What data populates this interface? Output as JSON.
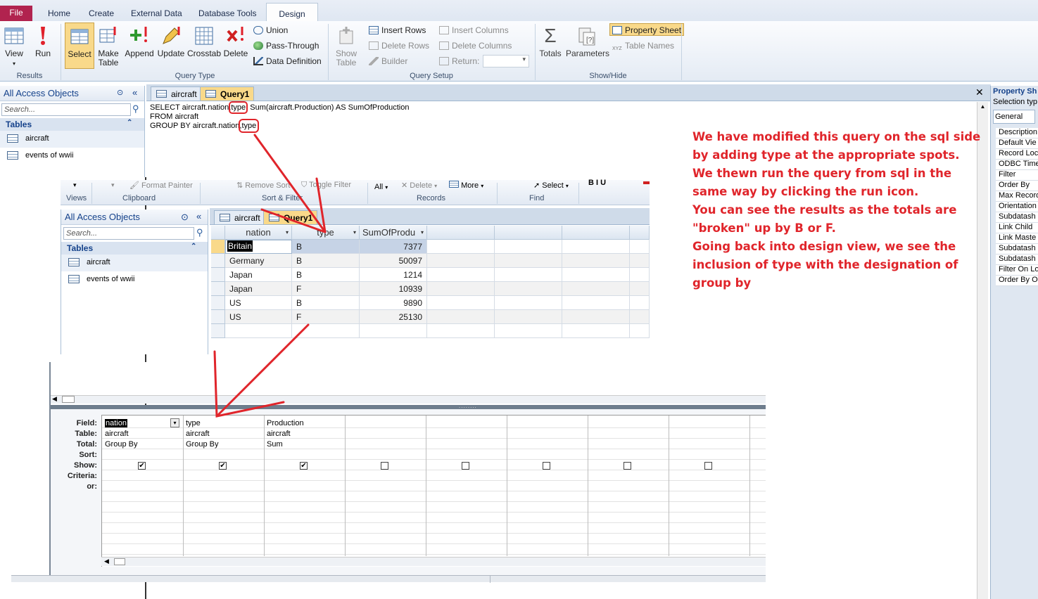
{
  "ribbon": {
    "tabs": [
      "File",
      "Home",
      "Create",
      "External Data",
      "Database Tools",
      "Design"
    ],
    "results": {
      "view": "View",
      "run": "Run",
      "label": "Results"
    },
    "query_type": {
      "select": "Select",
      "make_table_1": "Make",
      "make_table_2": "Table",
      "append": "Append",
      "update": "Update",
      "crosstab": "Crosstab",
      "delete": "Delete",
      "union": "Union",
      "pass_through": "Pass-Through",
      "data_definition": "Data Definition",
      "label": "Query Type"
    },
    "query_setup": {
      "show_table_1": "Show",
      "show_table_2": "Table",
      "insert_rows": "Insert Rows",
      "delete_rows": "Delete Rows",
      "builder": "Builder",
      "insert_columns": "Insert Columns",
      "delete_columns": "Delete Columns",
      "return": "Return:",
      "label": "Query Setup"
    },
    "show_hide": {
      "totals": "Totals",
      "parameters": "Parameters",
      "property_sheet": "Property Sheet",
      "table_names": "Table Names",
      "label": "Show/Hide"
    }
  },
  "nav": {
    "title": "All Access Objects",
    "search_placeholder": "Search...",
    "group": "Tables",
    "items": [
      "aircraft",
      "events of wwii"
    ]
  },
  "doc_tabs": [
    "aircraft",
    "Query1"
  ],
  "sql": {
    "line1a": "SELECT aircraft.nation,",
    "line1b": "type",
    "line1c": ", Sum(aircraft.Production) AS SumOfProduction",
    "line2": "FROM aircraft",
    "line3a": "GROUP BY aircraft.nation,",
    "line3b": "type"
  },
  "home_ribbon": {
    "format_painter": "Format Painter",
    "remove_sort": "Remove Sort",
    "toggle_filter": "Toggle Filter",
    "all": "All",
    "delete": "Delete",
    "more": "More",
    "select": "Select",
    "views": "Views",
    "clipboard": "Clipboard",
    "sort_filter": "Sort & Filter",
    "records": "Records",
    "find": "Find"
  },
  "datasheet": {
    "headers": [
      "nation",
      "type",
      "SumOfProdu"
    ],
    "rows": [
      [
        "Britain",
        "B",
        "7377"
      ],
      [
        "Germany",
        "B",
        "50097"
      ],
      [
        "Japan",
        "B",
        "1214"
      ],
      [
        "Japan",
        "F",
        "10939"
      ],
      [
        "US",
        "B",
        "9890"
      ],
      [
        "US",
        "F",
        "25130"
      ]
    ]
  },
  "annotation": [
    "We have modified this query on the sql side",
    "by adding type at the appropriate spots.",
    "We thewn run the query from sql in the",
    "same way by clicking the run icon.",
    "You can see the results as the totals are",
    "\"broken\" up by B or F.",
    "Going back into design view, we see the",
    "inclusion of type with the designation of",
    "group by"
  ],
  "qbe": {
    "labels": [
      "Field:",
      "Table:",
      "Total:",
      "Sort:",
      "Show:",
      "Criteria:",
      "or:"
    ],
    "columns": [
      {
        "field": "nation",
        "table": "aircraft",
        "total": "Group By",
        "show": true
      },
      {
        "field": "type",
        "table": "aircraft",
        "total": "Group By",
        "show": true
      },
      {
        "field": "Production",
        "table": "aircraft",
        "total": "Sum",
        "show": true
      },
      {
        "field": "",
        "table": "",
        "total": "",
        "show": false
      },
      {
        "field": "",
        "table": "",
        "total": "",
        "show": false
      },
      {
        "field": "",
        "table": "",
        "total": "",
        "show": false
      },
      {
        "field": "",
        "table": "",
        "total": "",
        "show": false
      },
      {
        "field": "",
        "table": "",
        "total": "",
        "show": false
      }
    ]
  },
  "property_sheet": {
    "title": "Property Sh",
    "selection": "Selection typ",
    "tab": "General",
    "items": [
      "Description",
      "Default Vie",
      "Record Loc",
      "ODBC Time",
      "Filter",
      "Order By",
      "Max Record",
      "Orientation",
      "Subdatash",
      "Link Child",
      "Link Maste",
      "Subdatash",
      "Subdatash",
      "Filter On Lo",
      "Order By O"
    ]
  },
  "colors": {
    "annotation": "#e0252b",
    "file_tab": "#b1234f",
    "selected_button": "#f9d98a"
  }
}
